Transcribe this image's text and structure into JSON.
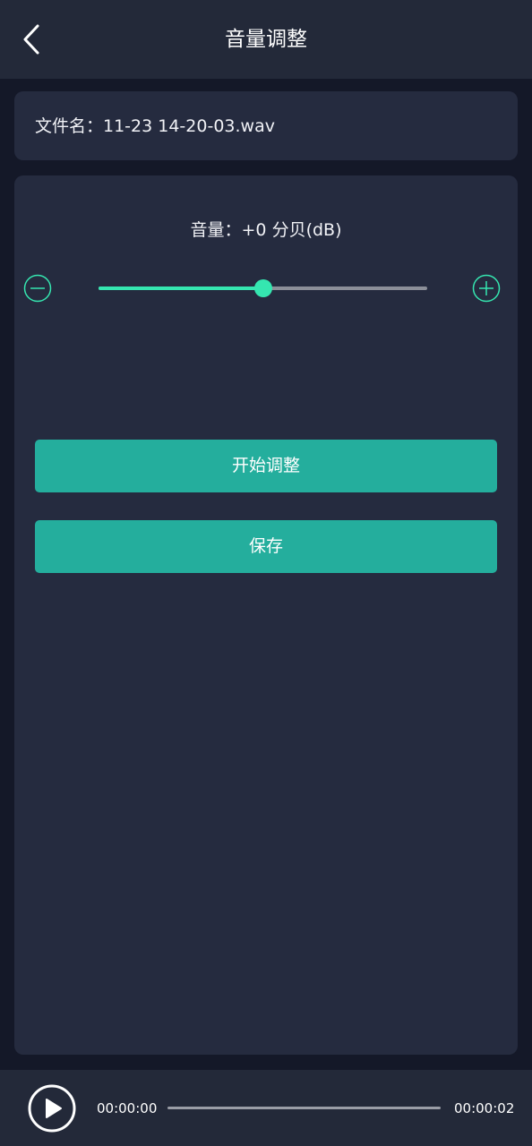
{
  "header": {
    "title": "音量调整",
    "back_icon": "chevron-left-icon"
  },
  "file": {
    "label": "文件名：11-23 14-20-03.wav"
  },
  "volume": {
    "label": "音量：+0 分贝(dB)",
    "level_fraction": 0.5,
    "decrease_icon": "minus-circle-icon",
    "increase_icon": "plus-circle-icon"
  },
  "actions": {
    "start_label": "开始调整",
    "save_label": "保存"
  },
  "player": {
    "play_icon": "play-icon",
    "current_time": "00:00:00",
    "total_time": "00:00:02",
    "progress_fraction": 0
  },
  "colors": {
    "accent": "#35e6b0",
    "button": "#24ae9d",
    "panel": "#252b3f",
    "background": "#141828",
    "bar": "#232939"
  }
}
